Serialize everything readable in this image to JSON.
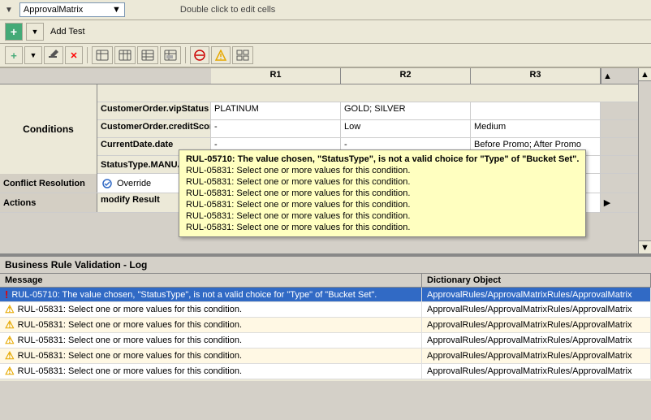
{
  "titlebar": {
    "dropdown_value": "ApprovalMatrix",
    "hint": "Double click to edit cells",
    "dropdown_arrow": "▼"
  },
  "toolbar1": {
    "add_label": "Add Test",
    "plus_icon": "+",
    "arrow_icon": "▼"
  },
  "toolbar2": {
    "icons": [
      "plus_arrow",
      "pencil",
      "delete",
      "table1",
      "table2",
      "table3",
      "table4",
      "block",
      "warning",
      "grid"
    ]
  },
  "grid": {
    "headers": [
      "R1",
      "R2",
      "R3"
    ],
    "section_conditions": "Conditions",
    "section_conflict": "Conflict Resolution",
    "section_actions": "Actions",
    "rows": [
      {
        "label": "CustomerOrder.vipStatus",
        "r1": "PLATINUM",
        "r2": "GOLD; SILVER",
        "r3": ""
      },
      {
        "label": "CustomerOrder.creditScore",
        "r1": "-",
        "r2": "Low",
        "r3": "Medium"
      },
      {
        "label": "CurrentDate.date",
        "r1": "-",
        "r2": "-",
        "r3": "Before Promo; After Promo"
      },
      {
        "label": "StatusType.MANUAL",
        "r1": "?",
        "r2": "?",
        "r3": "?"
      }
    ],
    "conflict_value": "Override",
    "actions_label": "modify Result",
    "actions_r3_checked": true
  },
  "tooltip": {
    "lines": [
      "RUL-05710: The value chosen, \"StatusType\", is not a valid choice for \"Type\" of \"Bucket Set\".",
      "RUL-05831: Select one or more values for this condition.",
      "RUL-05831: Select one or more values for this condition.",
      "RUL-05831: Select one or more values for this condition.",
      "RUL-05831: Select one or more values for this condition.",
      "RUL-05831: Select one or more values for this condition.",
      "RUL-05831: Select one or more values for this condition."
    ]
  },
  "validation": {
    "title": "Business Rule Validation - Log",
    "col_message": "Message",
    "col_dict": "Dictionary Object",
    "rows": [
      {
        "type": "error",
        "message": "RUL-05710: The value chosen, \"StatusType\", is not a valid choice for \"Type\" of \"Bucket Set\".",
        "dict": "ApprovalRules/ApprovalMatrixRules/ApprovalMatrix",
        "highlighted": true
      },
      {
        "type": "warning",
        "message": "RUL-05831: Select one or more values for this condition.",
        "dict": "ApprovalRules/ApprovalMatrixRules/ApprovalMatrix",
        "highlighted": false
      },
      {
        "type": "warning",
        "message": "RUL-05831: Select one or more values for this condition.",
        "dict": "ApprovalRules/ApprovalMatrixRules/ApprovalMatrix",
        "highlighted": false
      },
      {
        "type": "warning",
        "message": "RUL-05831: Select one or more values for this condition.",
        "dict": "ApprovalRules/ApprovalMatrixRules/ApprovalMatrix",
        "highlighted": false
      },
      {
        "type": "warning",
        "message": "RUL-05831: Select one or more values for this condition.",
        "dict": "ApprovalRules/ApprovalMatrixRules/ApprovalMatrix",
        "highlighted": false
      },
      {
        "type": "warning",
        "message": "RUL-05831: Select one or more values for this condition.",
        "dict": "ApprovalRules/ApprovalMatrixRules/ApprovalMatrix",
        "highlighted": false
      }
    ]
  }
}
